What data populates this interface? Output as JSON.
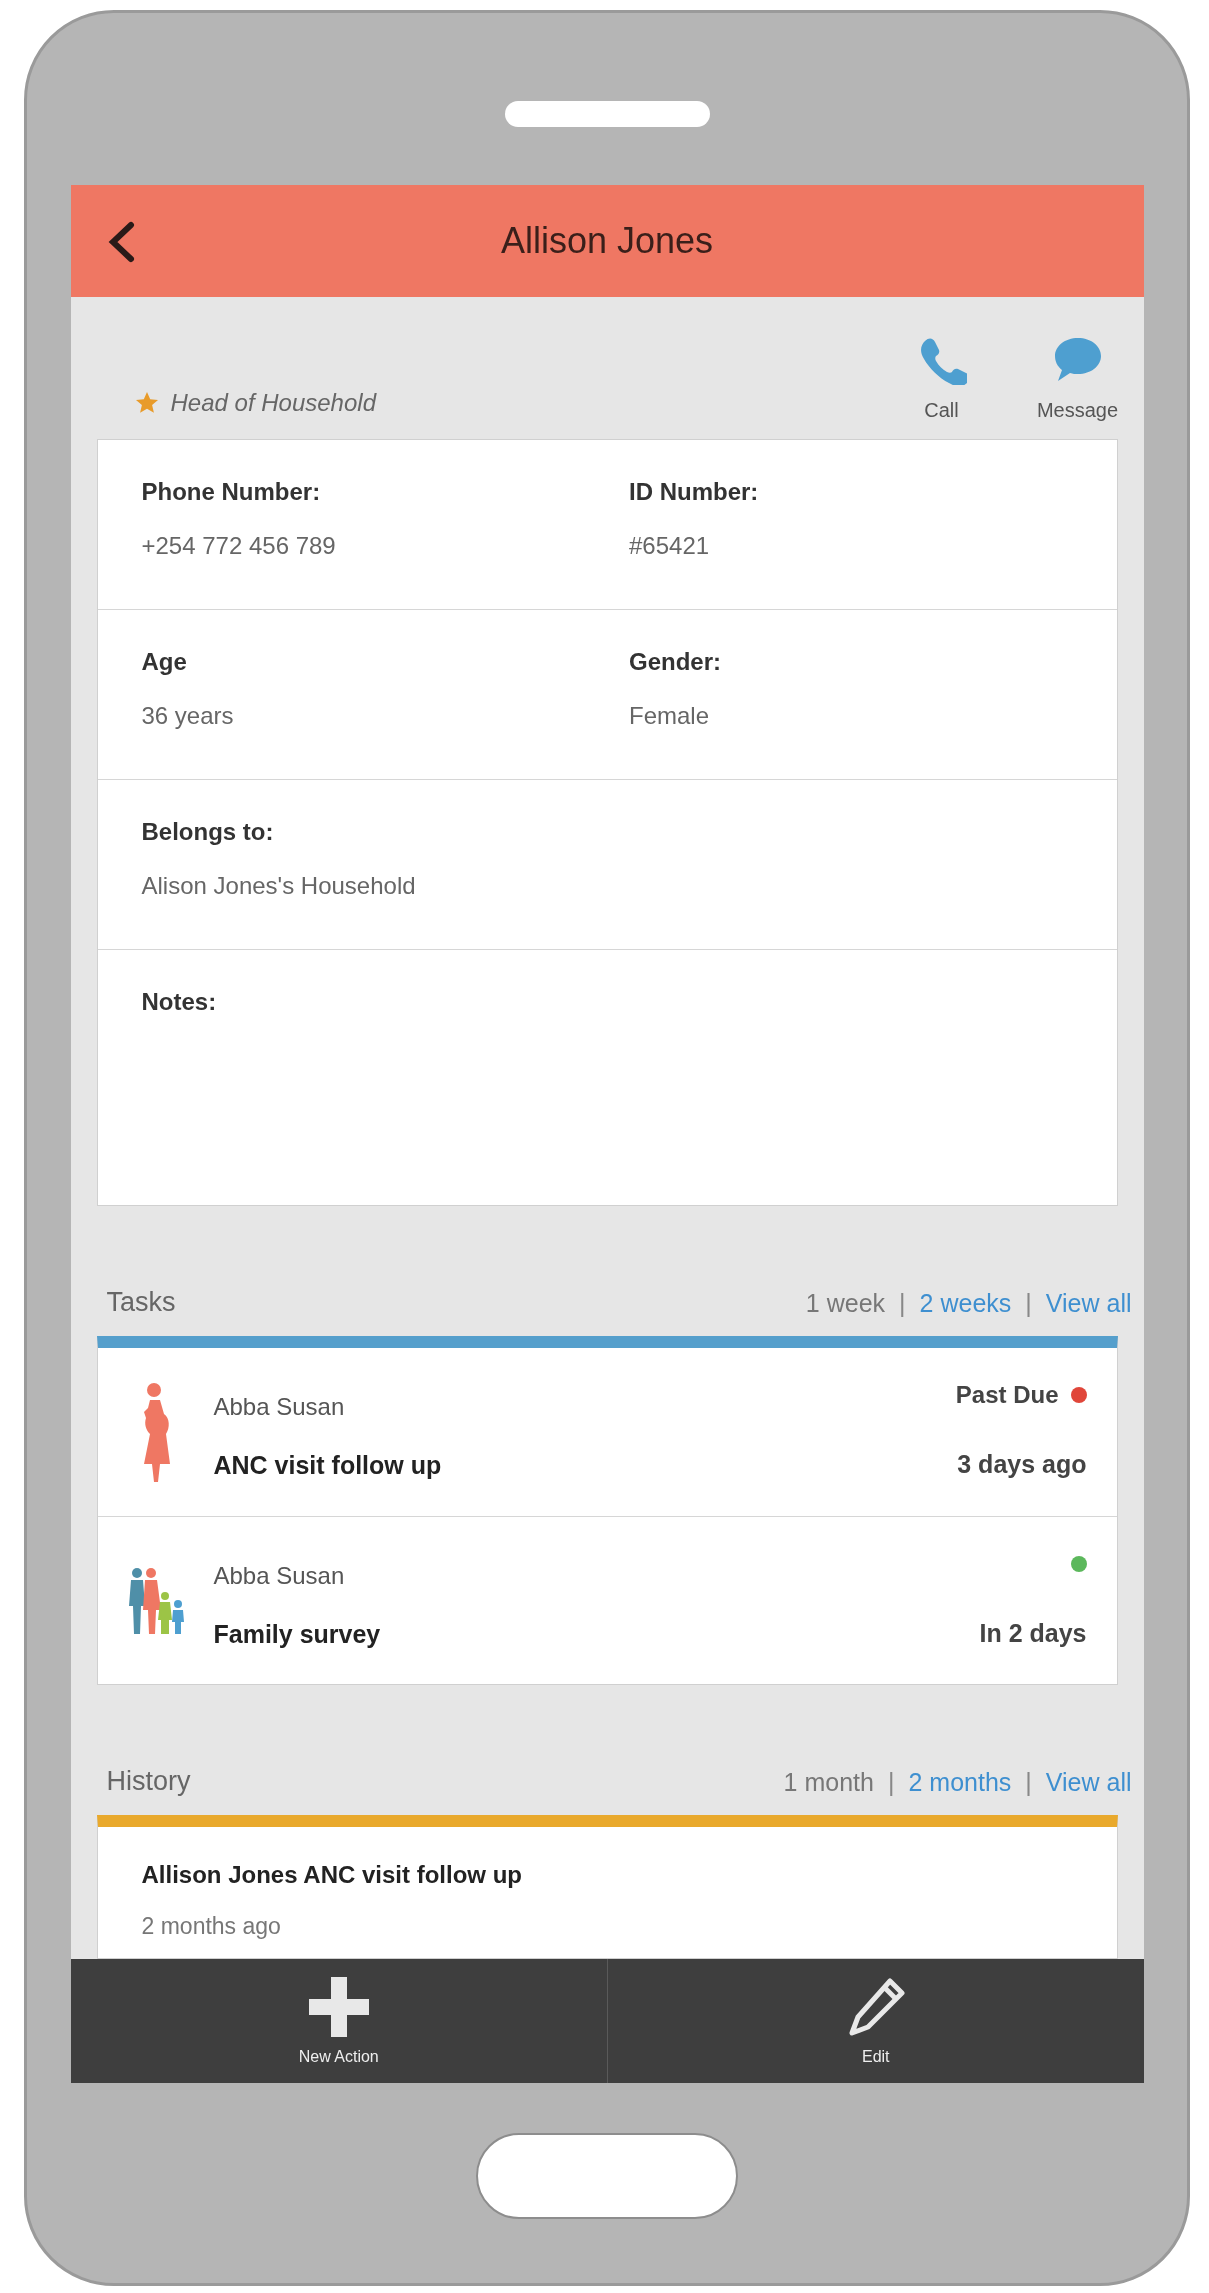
{
  "header": {
    "title": "Allison Jones"
  },
  "profile": {
    "role": "Head of Household",
    "actions": [
      {
        "label": "Call",
        "kind": "phone"
      },
      {
        "label": "Message",
        "kind": "message"
      }
    ]
  },
  "details": {
    "rows": [
      [
        {
          "label": "Phone Number:",
          "value": "+254 772 456 789"
        },
        {
          "label": "ID Number:",
          "value": "#65421"
        }
      ],
      [
        {
          "label": "Age",
          "value": "36 years"
        },
        {
          "label": "Gender:",
          "value": "Female"
        }
      ],
      [
        {
          "label": "Belongs to:",
          "value": "Alison Jones's Household"
        }
      ]
    ],
    "notes_label": "Notes:"
  },
  "tasks": {
    "title": "Tasks",
    "filters": [
      {
        "kind": "filter",
        "label": "1 week",
        "link": false
      },
      {
        "kind": "separator",
        "label": "|"
      },
      {
        "kind": "filter",
        "label": "2 weeks",
        "link": true
      },
      {
        "kind": "separator",
        "label": "|"
      },
      {
        "kind": "filter",
        "label": "View all",
        "link": true
      }
    ],
    "items": [
      {
        "kind": "pregnant",
        "person": "Abba Susan",
        "title": "ANC visit follow up",
        "status": "Past Due",
        "color": "#e0463a",
        "due": "3 days ago"
      },
      {
        "kind": "family",
        "person": "Abba Susan",
        "title": "Family survey",
        "color": "#5cb85c",
        "due": "In 2 days"
      }
    ]
  },
  "history": {
    "title": "History",
    "filters": [
      {
        "kind": "filter",
        "label": "1 month",
        "link": false
      },
      {
        "kind": "separator",
        "label": "|"
      },
      {
        "kind": "filter",
        "label": "2 months",
        "link": true
      },
      {
        "kind": "separator",
        "label": "|"
      },
      {
        "kind": "filter",
        "label": "View all",
        "link": true
      }
    ],
    "items": [
      {
        "title": "Allison Jones ANC visit follow up",
        "time": "2 months ago"
      }
    ]
  },
  "bottom_bar": [
    {
      "label": "New Action",
      "kind": "plus"
    },
    {
      "label": "Edit",
      "kind": "pencil"
    }
  ]
}
